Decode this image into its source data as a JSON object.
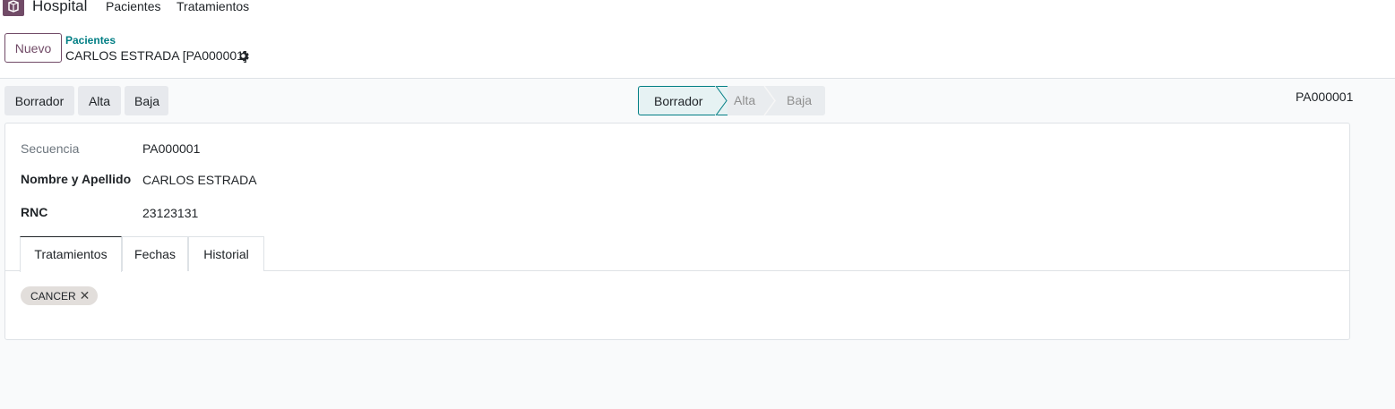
{
  "navbar": {
    "app_name": "Hospital",
    "menu": [
      "Pacientes",
      "Tratamientos"
    ]
  },
  "control_panel": {
    "new_button": "Nuevo",
    "breadcrumb_parent": "Pacientes",
    "breadcrumb_current": "CARLOS ESTRADA [PA000001]"
  },
  "statusbar": {
    "buttons": [
      "Borrador",
      "Alta",
      "Baja"
    ],
    "stages": [
      "Borrador",
      "Alta",
      "Baja"
    ],
    "active_stage": "Borrador",
    "record_ref": "PA000001"
  },
  "form": {
    "fields": [
      {
        "label": "Secuencia",
        "value": "PA000001"
      },
      {
        "label": "Nombre y Apellido",
        "value": "CARLOS ESTRADA"
      },
      {
        "label": "RNC",
        "value": "23123131"
      }
    ],
    "tabs": [
      "Tratamientos",
      "Fechas",
      "Historial"
    ],
    "active_tab": "Tratamientos",
    "tags": [
      {
        "label": "CANCER",
        "remove": "✕"
      }
    ]
  },
  "colors": {
    "brand": "#714b67",
    "link": "#017e84",
    "active_stage_bg": "#e6f2f3"
  }
}
